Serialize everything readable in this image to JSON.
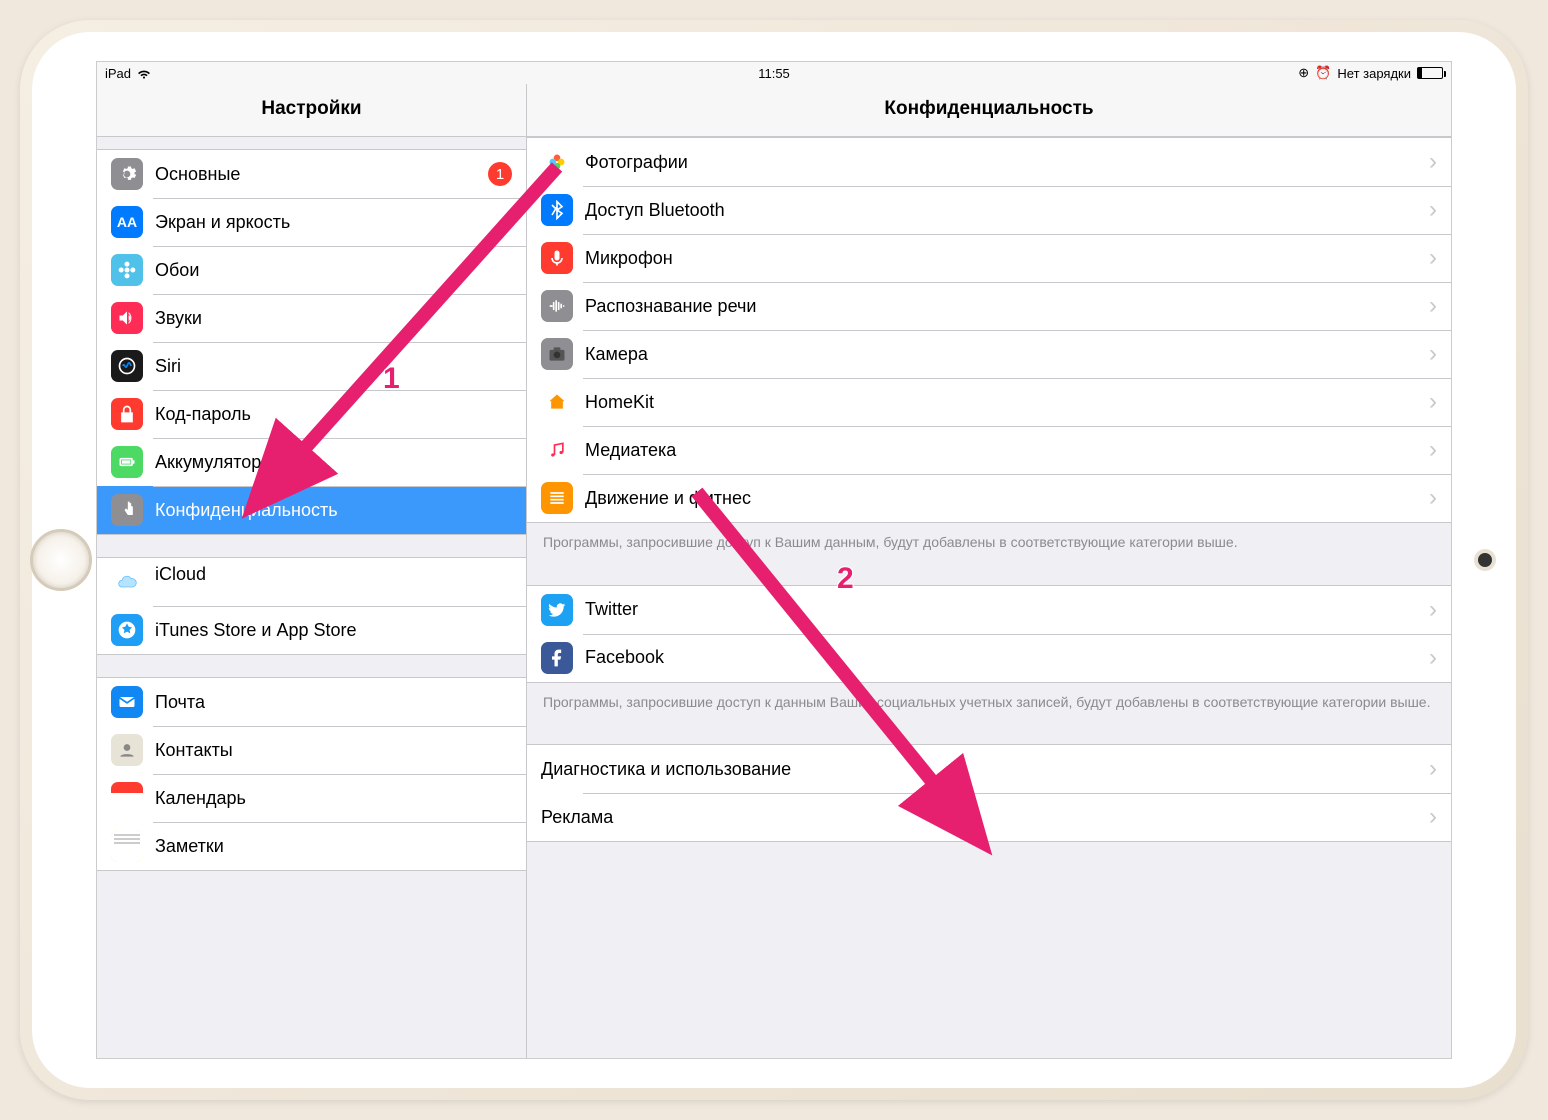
{
  "status": {
    "device": "iPad",
    "time": "11:55",
    "charge_text": "Нет зарядки"
  },
  "sidebar": {
    "title": "Настройки",
    "groups": [
      [
        {
          "id": "general",
          "label": "Основные",
          "icon": "gear",
          "color": "#8e8e93",
          "badge": "1"
        },
        {
          "id": "display",
          "label": "Экран и яркость",
          "icon": "aa",
          "color": "#007aff"
        },
        {
          "id": "wallpaper",
          "label": "Обои",
          "icon": "flower",
          "color": "#50c1e9"
        },
        {
          "id": "sounds",
          "label": "Звуки",
          "icon": "speaker",
          "color": "#ff2d55"
        },
        {
          "id": "siri",
          "label": "Siri",
          "icon": "siri",
          "color": "#000"
        },
        {
          "id": "passcode",
          "label": "Код-пароль",
          "icon": "lock",
          "color": "#ff3b30"
        },
        {
          "id": "battery",
          "label": "Аккумулятор",
          "icon": "battery",
          "color": "#4cd964"
        },
        {
          "id": "privacy",
          "label": "Конфиденциальность",
          "icon": "hand",
          "color": "#8e8e93",
          "selected": true
        }
      ],
      [
        {
          "id": "icloud",
          "label": "iCloud",
          "icon": "cloud",
          "color": "#fff",
          "sub": ""
        },
        {
          "id": "itunes",
          "label": "iTunes Store и App Store",
          "icon": "appstore",
          "color": "#1e9ef4"
        }
      ],
      [
        {
          "id": "mail",
          "label": "Почта",
          "icon": "mail",
          "color": "#1187f3"
        },
        {
          "id": "contacts",
          "label": "Контакты",
          "icon": "contacts",
          "color": "#d9d4c9"
        },
        {
          "id": "calendar",
          "label": "Календарь",
          "icon": "calendar",
          "color": "#fff"
        },
        {
          "id": "notes",
          "label": "Заметки",
          "icon": "notes",
          "color": "#ffd02e"
        }
      ]
    ]
  },
  "detail": {
    "title": "Конфиденциальность",
    "sections": [
      {
        "rows": [
          {
            "id": "photos",
            "label": "Фотографии",
            "icon": "photos"
          },
          {
            "id": "bluetooth",
            "label": "Доступ Bluetooth",
            "icon": "bluetooth",
            "color": "#007aff"
          },
          {
            "id": "mic",
            "label": "Микрофон",
            "icon": "mic",
            "color": "#ff3b30"
          },
          {
            "id": "speech",
            "label": "Распознавание речи",
            "icon": "wave",
            "color": "#8e8e93"
          },
          {
            "id": "camera",
            "label": "Камера",
            "icon": "camera",
            "color": "#8e8e93"
          },
          {
            "id": "homekit",
            "label": "HomeKit",
            "icon": "home",
            "color": "#fff"
          },
          {
            "id": "media",
            "label": "Медиатека",
            "icon": "music",
            "color": "#fff"
          },
          {
            "id": "motion",
            "label": "Движение и фитнес",
            "icon": "motion",
            "color": "#ff9500"
          }
        ],
        "footnote": "Программы, запросившие доступ к Вашим данным, будут добавлены в соответствующие категории выше."
      },
      {
        "rows": [
          {
            "id": "twitter",
            "label": "Twitter",
            "icon": "twitter",
            "color": "#1da1f2"
          },
          {
            "id": "facebook",
            "label": "Facebook",
            "icon": "facebook",
            "color": "#3b5998"
          }
        ],
        "footnote": "Программы, запросившие доступ к данным Ваших социальных учетных записей, будут добавлены в соответствующие категории выше."
      },
      {
        "rows": [
          {
            "id": "diagnostics",
            "label": "Диагностика и использование",
            "noicon": true
          },
          {
            "id": "ads",
            "label": "Реклама",
            "noicon": true
          }
        ]
      }
    ]
  },
  "annotations": {
    "label1": "1",
    "label2": "2"
  }
}
